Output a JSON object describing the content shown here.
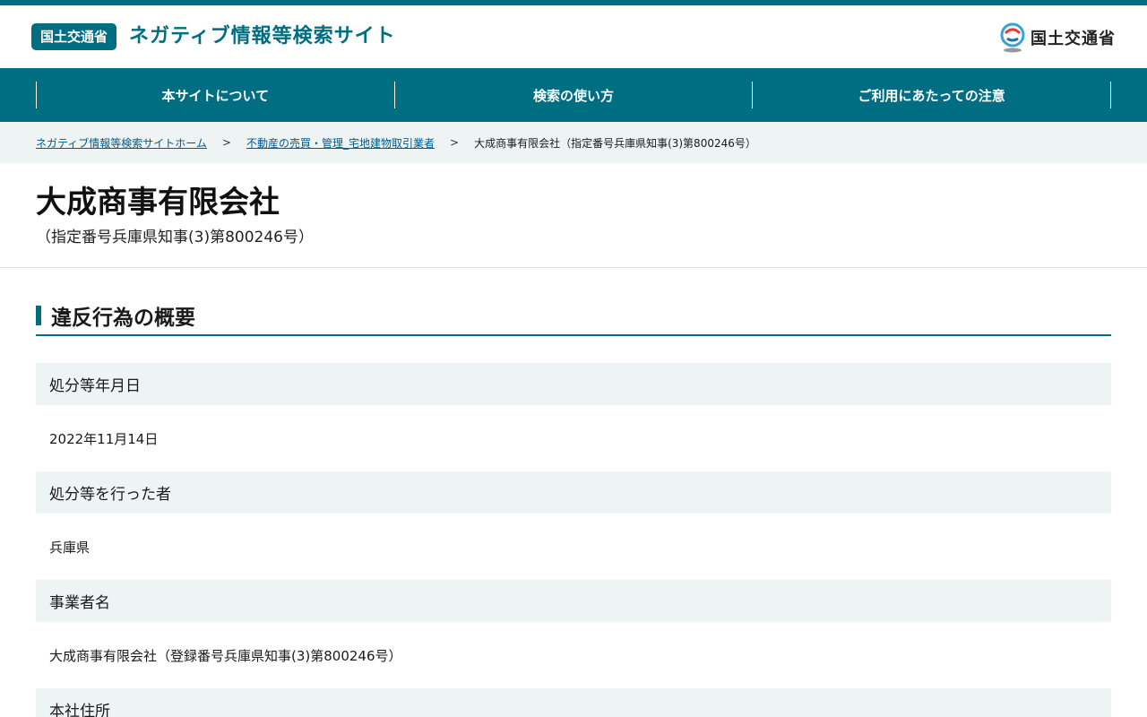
{
  "header": {
    "badge": "国土交通省",
    "site_title": "ネガティブ情報等検索サイト",
    "ministry_name": "国土交通省"
  },
  "nav": [
    {
      "label": "本サイトについて"
    },
    {
      "label": "検索の使い方"
    },
    {
      "label": "ご利用にあたっての注意"
    }
  ],
  "breadcrumb": {
    "home": "ネガティブ情報等検索サイトホーム",
    "category": "不動産の売買・管理_宅地建物取引業者",
    "current": "大成商事有限会社（指定番号兵庫県知事(3)第800246号）",
    "separator": ">"
  },
  "page": {
    "title": "大成商事有限会社",
    "subtitle": "（指定番号兵庫県知事(3)第800246号）"
  },
  "section": {
    "heading": "違反行為の概要"
  },
  "details": [
    {
      "label": "処分等年月日",
      "value": "2022年11月14日"
    },
    {
      "label": "処分等を行った者",
      "value": "兵庫県"
    },
    {
      "label": "事業者名",
      "value": "大成商事有限会社（登録番号兵庫県知事(3)第800246号）"
    },
    {
      "label": "本社住所",
      "value": ""
    }
  ],
  "colors": {
    "brand": "#006e82",
    "light_bg": "#eef3f4",
    "link": "#005a8c"
  }
}
